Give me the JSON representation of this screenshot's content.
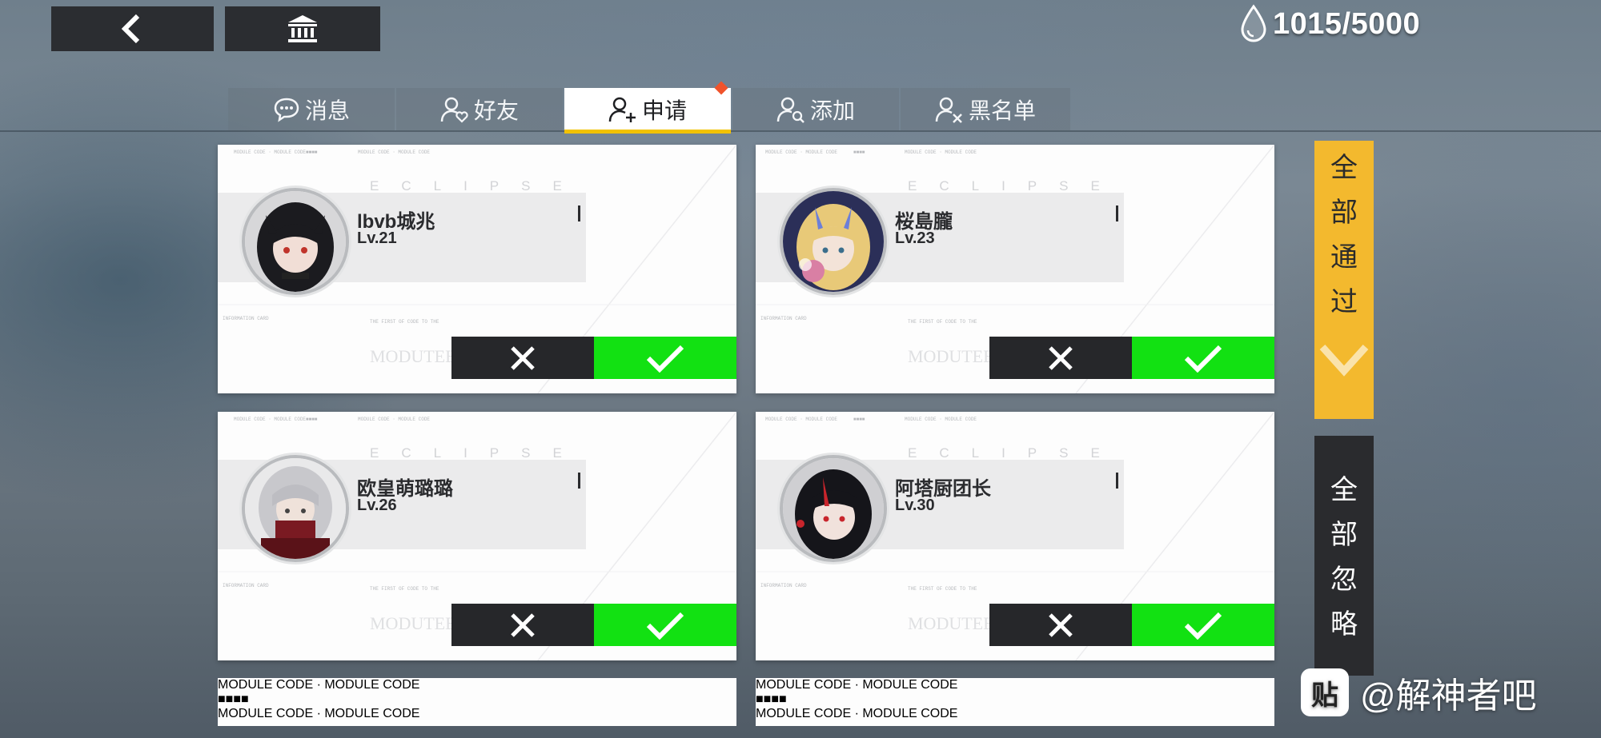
{
  "header": {
    "back_icon": "chevron-left-icon",
    "home_icon": "bank-icon",
    "currency_icon": "water-drop-icon",
    "currency": "1015/5000"
  },
  "tabs": [
    {
      "label": "消息",
      "icon": "chat-bubble-icon",
      "active": false
    },
    {
      "label": "好友",
      "icon": "friend-heart-icon",
      "active": false
    },
    {
      "label": "申请",
      "icon": "user-add-icon",
      "active": true
    },
    {
      "label": "添加",
      "icon": "user-search-icon",
      "active": false
    },
    {
      "label": "黑名单",
      "icon": "user-block-icon",
      "active": false
    }
  ],
  "decor": {
    "eclipse": "ECLIPSE",
    "module": "MODUTEE"
  },
  "requests": [
    {
      "name": "lbvb城兆",
      "level": "Lv.21"
    },
    {
      "name": "桜島朧",
      "level": "Lv.23"
    },
    {
      "name": "欧皇萌璐璐",
      "level": "Lv.26"
    },
    {
      "name": "阿塔厨团长",
      "level": "Lv.30"
    }
  ],
  "side_actions": {
    "approve_all": "全部通过",
    "ignore_all": "全部忽略"
  },
  "watermark": {
    "logo_char": "贴",
    "text": "@解神者吧"
  },
  "colors": {
    "accept": "#12e112",
    "reject": "#26272a",
    "approve_all_bg": "#f3b92e",
    "tab_indicator": "#f2c200",
    "notification_dot": "#f0532b"
  }
}
